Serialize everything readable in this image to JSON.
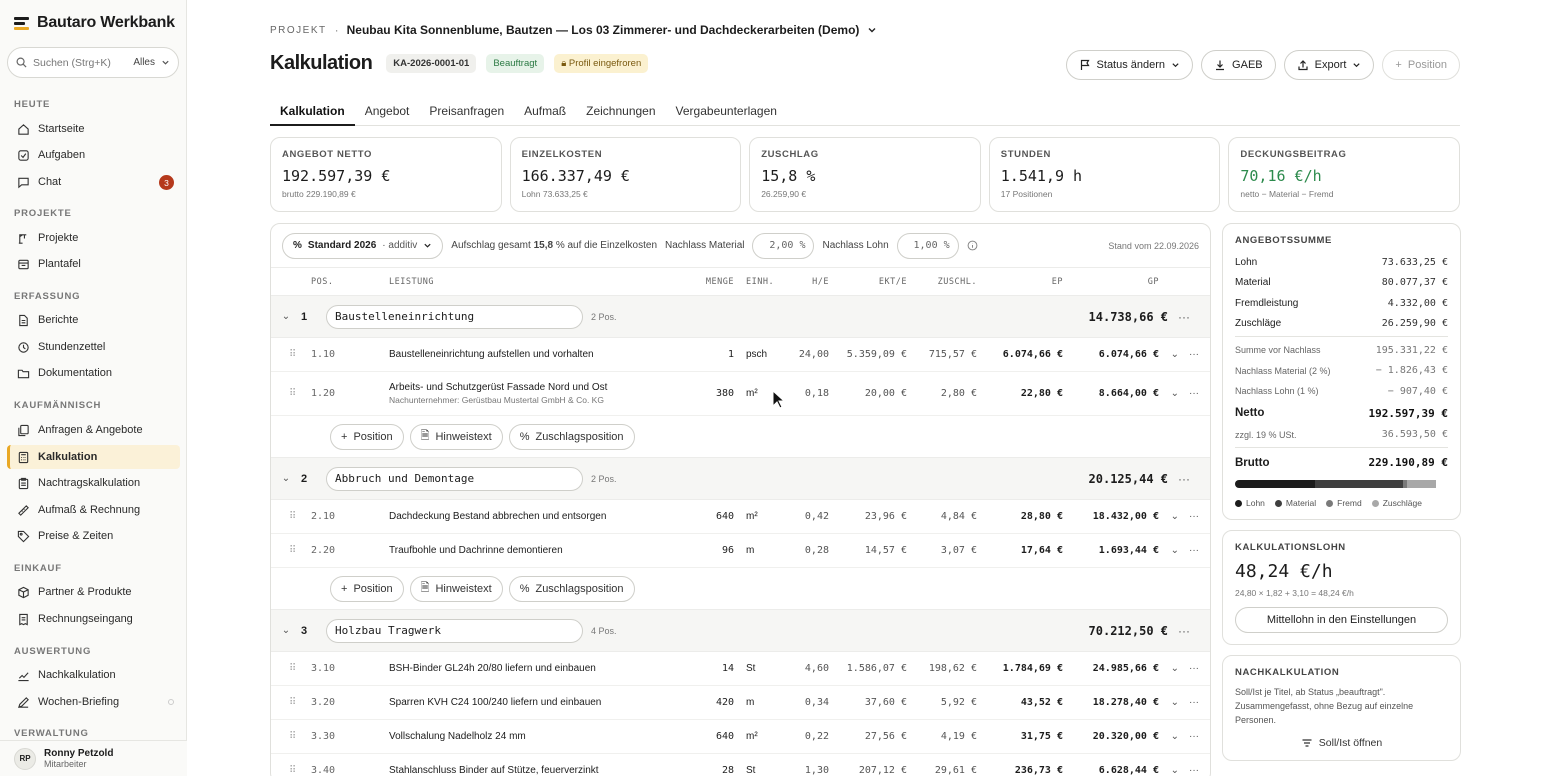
{
  "brand": {
    "name": "Bautaro Werkbank"
  },
  "search": {
    "placeholder": "Suchen (Strg+K)",
    "scope": "Alles"
  },
  "nav": {
    "sections": [
      {
        "label": "HEUTE"
      },
      {
        "label": "PROJEKTE"
      },
      {
        "label": "ERFASSUNG"
      },
      {
        "label": "KAUFMÄNNISCH"
      },
      {
        "label": "EINKAUF"
      },
      {
        "label": "AUSWERTUNG"
      },
      {
        "label": "VERWALTUNG"
      }
    ],
    "items": [
      {
        "label": "Startseite",
        "icon": "home-icon"
      },
      {
        "label": "Aufgaben",
        "icon": "check-square-icon"
      },
      {
        "label": "Chat",
        "icon": "chat-icon",
        "badge": "3"
      },
      {
        "label": "Projekte",
        "icon": "crane-icon"
      },
      {
        "label": "Plantafel",
        "icon": "calendar-board-icon"
      },
      {
        "label": "Berichte",
        "icon": "file-icon"
      },
      {
        "label": "Stundenzettel",
        "icon": "clock-icon"
      },
      {
        "label": "Dokumentation",
        "icon": "folder-icon"
      },
      {
        "label": "Anfragen & Angebote",
        "icon": "copy-icon"
      },
      {
        "label": "Kalkulation",
        "icon": "calculator-icon"
      },
      {
        "label": "Nachtragskalkulation",
        "icon": "clipboard-icon"
      },
      {
        "label": "Aufmaß & Rechnung",
        "icon": "ruler-icon"
      },
      {
        "label": "Preise & Zeiten",
        "icon": "tag-icon"
      },
      {
        "label": "Partner & Produkte",
        "icon": "package-icon"
      },
      {
        "label": "Rechnungseingang",
        "icon": "receipt-icon"
      },
      {
        "label": "Nachkalkulation",
        "icon": "chart-line-icon"
      },
      {
        "label": "Wochen-Briefing",
        "icon": "pen-icon"
      }
    ]
  },
  "user": {
    "initials": "RP",
    "name": "Ronny Petzold",
    "role": "Mitarbeiter"
  },
  "header": {
    "crumb_label": "PROJEKT",
    "crumb_sep": "·",
    "project": "Neubau Kita Sonnenblume, Bautzen — Los 03 Zimmerer- und Dachdeckerarbeiten (Demo)",
    "title": "Kalkulation",
    "doc_id": "KA-2026-0001-01",
    "status": "Beauftragt",
    "frozen": "Profil eingefroren",
    "actions": {
      "status": "Status ändern",
      "gaeb": "GAEB",
      "export": "Export",
      "position": "Position"
    }
  },
  "tabs": [
    "Kalkulation",
    "Angebot",
    "Preisanfragen",
    "Aufmaß",
    "Zeichnungen",
    "Vergabeunterlagen"
  ],
  "kpis": [
    {
      "label": "ANGEBOT NETTO",
      "value": "192.597,39 €",
      "sub": "brutto 229.190,89 €"
    },
    {
      "label": "EINZELKOSTEN",
      "value": "166.337,49 €",
      "sub": "Lohn 73.633,25 €"
    },
    {
      "label": "ZUSCHLAG",
      "value": "15,8 %",
      "sub": "26.259,90 €"
    },
    {
      "label": "STUNDEN",
      "value": "1.541,9 h",
      "sub": "17 Positionen"
    },
    {
      "label": "DECKUNGSBEITRAG",
      "value": "70,16 €/h",
      "sub": "netto − Material − Fremd"
    }
  ],
  "toolbar": {
    "profile": "Standard 2026",
    "profile_mode": "· additiv",
    "aufschlag_pre": "Aufschlag gesamt",
    "aufschlag_val": "15,8",
    "aufschlag_post": "% auf die Einzelkosten",
    "nl_material_label": "Nachlass Material",
    "nl_material_val": "2,00 %",
    "nl_lohn_label": "Nachlass Lohn",
    "nl_lohn_val": "1,00 %",
    "stand": "Stand vom 22.09.2026"
  },
  "columns": {
    "pos": "POS.",
    "leistung": "LEISTUNG",
    "menge": "MENGE",
    "einh": "EINH.",
    "he": "H/E",
    "ekt": "EKT/E",
    "zu": "ZUSCHL.",
    "ep": "EP",
    "gp": "GP"
  },
  "add_buttons": {
    "position": "Position",
    "hinweis": "Hinweistext",
    "zuschlag": "Zuschlagsposition"
  },
  "groups": [
    {
      "no": "1",
      "name": "Baustelleneinrichtung",
      "count": "2 Pos.",
      "sum": "14.738,66 €",
      "rows": [
        {
          "pos": "1.10",
          "text": "Baustelleneinrichtung aufstellen und vorhalten",
          "sub": "",
          "menge": "1",
          "einh": "psch",
          "he": "24,00",
          "ekt": "5.359,09 €",
          "zu": "715,57 €",
          "ep": "6.074,66 €",
          "gp": "6.074,66 €"
        },
        {
          "pos": "1.20",
          "text": "Arbeits- und Schutzgerüst Fassade Nord und Ost",
          "sub": "Nachunternehmer: Gerüstbau Mustertal GmbH & Co. KG",
          "menge": "380",
          "einh": "m²",
          "he": "0,18",
          "ekt": "20,00 €",
          "zu": "2,80 €",
          "ep": "22,80 €",
          "gp": "8.664,00 €"
        }
      ]
    },
    {
      "no": "2",
      "name": "Abbruch und Demontage",
      "count": "2 Pos.",
      "sum": "20.125,44 €",
      "rows": [
        {
          "pos": "2.10",
          "text": "Dachdeckung Bestand abbrechen und entsorgen",
          "sub": "",
          "menge": "640",
          "einh": "m²",
          "he": "0,42",
          "ekt": "23,96 €",
          "zu": "4,84 €",
          "ep": "28,80 €",
          "gp": "18.432,00 €"
        },
        {
          "pos": "2.20",
          "text": "Traufbohle und Dachrinne demontieren",
          "sub": "",
          "menge": "96",
          "einh": "m",
          "he": "0,28",
          "ekt": "14,57 €",
          "zu": "3,07 €",
          "ep": "17,64 €",
          "gp": "1.693,44 €"
        }
      ]
    },
    {
      "no": "3",
      "name": "Holzbau Tragwerk",
      "count": "4 Pos.",
      "sum": "70.212,50 €",
      "rows": [
        {
          "pos": "3.10",
          "text": "BSH-Binder GL24h 20/80 liefern und einbauen",
          "sub": "",
          "menge": "14",
          "einh": "St",
          "he": "4,60",
          "ekt": "1.586,07 €",
          "zu": "198,62 €",
          "ep": "1.784,69 €",
          "gp": "24.985,66 €"
        },
        {
          "pos": "3.20",
          "text": "Sparren KVH C24 100/240 liefern und einbauen",
          "sub": "",
          "menge": "420",
          "einh": "m",
          "he": "0,34",
          "ekt": "37,60 €",
          "zu": "5,92 €",
          "ep": "43,52 €",
          "gp": "18.278,40 €"
        },
        {
          "pos": "3.30",
          "text": "Vollschalung Nadelholz 24 mm",
          "sub": "",
          "menge": "640",
          "einh": "m²",
          "he": "0,22",
          "ekt": "27,56 €",
          "zu": "4,19 €",
          "ep": "31,75 €",
          "gp": "20.320,00 €"
        },
        {
          "pos": "3.40",
          "text": "Stahlanschluss Binder auf Stütze, feuerverzinkt",
          "sub": "",
          "menge": "28",
          "einh": "St",
          "he": "1,30",
          "ekt": "207,12 €",
          "zu": "29,61 €",
          "ep": "236,73 €",
          "gp": "6.628,44 €"
        }
      ]
    }
  ],
  "angebotssumme": {
    "title": "ANGEBOTSSUMME",
    "lines": [
      {
        "k": "Lohn",
        "v": "73.633,25 €"
      },
      {
        "k": "Material",
        "v": "80.077,37 €"
      },
      {
        "k": "Fremdleistung",
        "v": "4.332,00 €"
      },
      {
        "k": "Zuschläge",
        "v": "26.259,90 €"
      }
    ],
    "small": [
      {
        "k": "Summe vor Nachlass",
        "v": "195.331,22 €"
      },
      {
        "k": "Nachlass Material (2 %)",
        "v": "− 1.826,43 €"
      },
      {
        "k": "Nachlass Lohn (1 %)",
        "v": "− 907,40 €"
      }
    ],
    "netto": {
      "k": "Netto",
      "v": "192.597,39 €"
    },
    "ust": {
      "k": "zzgl. 19 % USt.",
      "v": "36.593,50 €"
    },
    "brutto": {
      "k": "Brutto",
      "v": "229.190,89 €"
    },
    "bar_shares": [
      0.377,
      0.41,
      0.022,
      0.134
    ],
    "bar_colors": [
      "#1c1c1c",
      "#3f3f3f",
      "#7a7a7a",
      "#a8a8a8"
    ],
    "legend": [
      "Lohn",
      "Material",
      "Fremd",
      "Zuschläge"
    ]
  },
  "kalklohn": {
    "title": "KALKULATIONSLOHN",
    "value": "48,24 €/h",
    "formula": "24,80 × 1,82 + 3,10 = 48,24 €/h",
    "button": "Mittellohn in den Einstellungen"
  },
  "nachkalk": {
    "title": "NACHKALKULATION",
    "text": "Soll/Ist je Titel, ab Status „beauftragt\". Zusammengefasst, ohne Bezug auf einzelne Personen.",
    "link": "Soll/Ist öffnen"
  },
  "colors": {
    "accent": "#e9a825",
    "green": "#2c8a4c",
    "badge": "#b5391c"
  }
}
